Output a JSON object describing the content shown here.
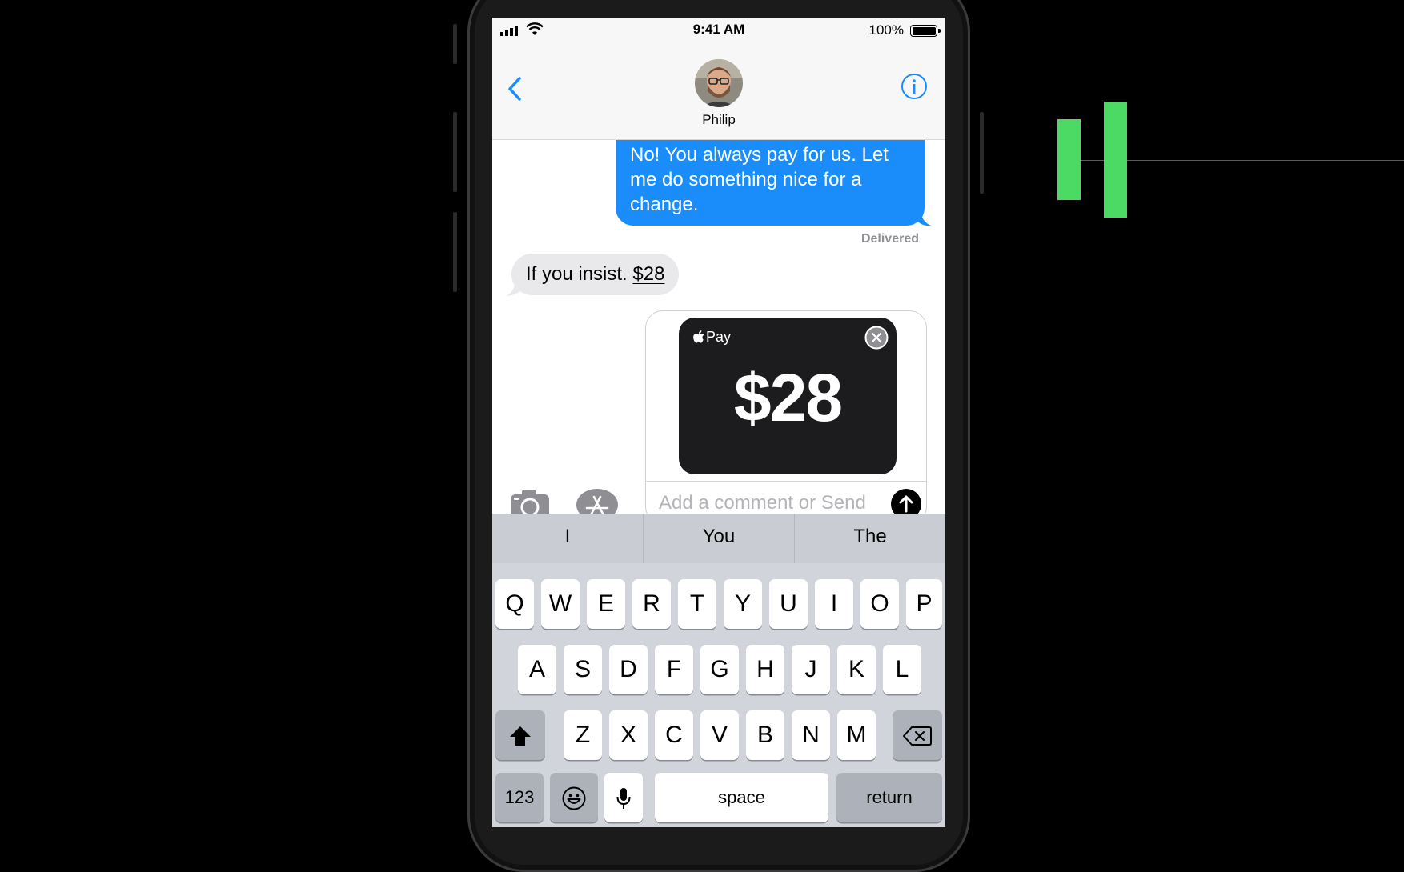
{
  "status_bar": {
    "time": "9:41 AM",
    "battery": "100%"
  },
  "header": {
    "contact_name": "Philip"
  },
  "messages": {
    "sent_text": "No! You always pay for us. Let me do something nice for a change.",
    "delivered_label": "Delivered",
    "received_prefix": "If you insist. ",
    "received_amount": "$28"
  },
  "apple_pay": {
    "logo_label": "Pay",
    "amount": "$28",
    "comment_placeholder": "Add a comment or Send"
  },
  "keyboard": {
    "suggestions": [
      "I",
      "You",
      "The"
    ],
    "row1": [
      "Q",
      "W",
      "E",
      "R",
      "T",
      "Y",
      "U",
      "I",
      "O",
      "P"
    ],
    "row2": [
      "A",
      "S",
      "D",
      "F",
      "G",
      "H",
      "J",
      "K",
      "L"
    ],
    "row3": [
      "Z",
      "X",
      "C",
      "V",
      "B",
      "N",
      "M"
    ],
    "numbers_label": "123",
    "space_label": "space",
    "return_label": "return"
  },
  "colors": {
    "accent": "#1a8dfb",
    "graphic_green": "#4cd964"
  }
}
